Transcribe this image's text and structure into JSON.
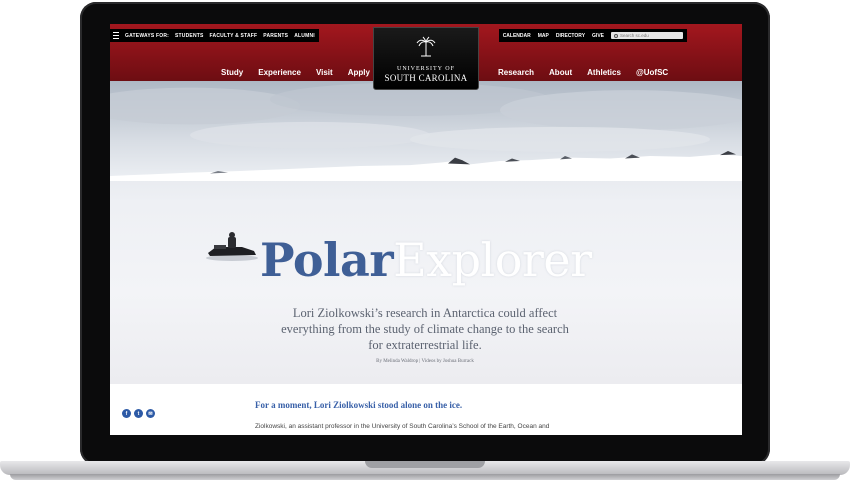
{
  "header": {
    "gateways_label": "GATEWAYS FOR:",
    "gateways": [
      "STUDENTS",
      "FACULTY & STAFF",
      "PARENTS",
      "ALUMNI"
    ],
    "utility_links": [
      "CALENDAR",
      "MAP",
      "DIRECTORY",
      "GIVE"
    ],
    "search_placeholder": "Search sc.edu",
    "logo_line1": "UNIVERSITY OF",
    "logo_line2": "SOUTH CAROLINA",
    "nav_left": [
      "Study",
      "Experience",
      "Visit",
      "Apply"
    ],
    "nav_right": [
      "Research",
      "About",
      "Athletics",
      "@UofSC"
    ],
    "colors": {
      "garnet": "#a3171e",
      "black": "#000000"
    }
  },
  "hero": {
    "title_part1": "Polar",
    "title_part2": "Explorer",
    "subtitle": "Lori Ziolkowski’s research in Antarctica could affect everything from the study of climate change to the search for extraterrestrial life.",
    "byline": "By Melinda Waldrop | Videos by Joshua Burrack",
    "colors": {
      "title_blue": "#3f5f96"
    }
  },
  "article": {
    "social": [
      {
        "icon": "facebook-icon",
        "glyph": "f"
      },
      {
        "icon": "twitter-icon",
        "glyph": "t"
      },
      {
        "icon": "email-icon",
        "glyph": "✉"
      }
    ],
    "lead": "For a moment, Lori Ziolkowski stood alone on the ice.",
    "body": "Ziolkowski, an assistant professor in the University of South Carolina’s School of the Earth, Ocean and"
  }
}
